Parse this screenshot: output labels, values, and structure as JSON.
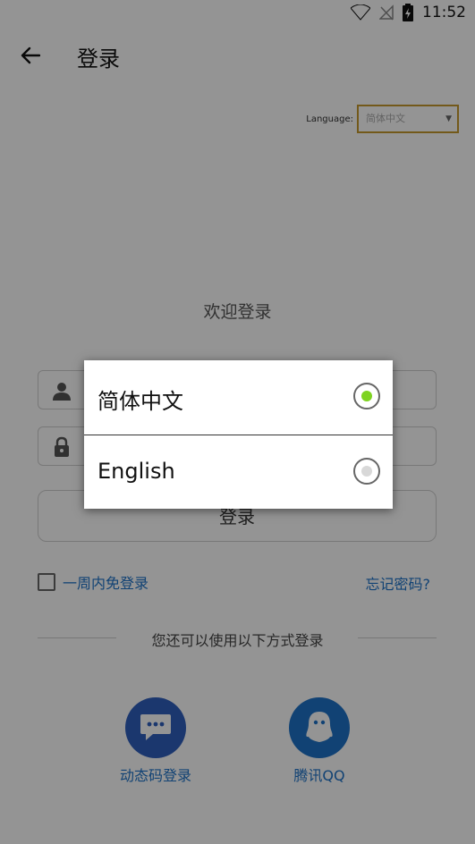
{
  "status_bar": {
    "time": "11:52",
    "icons": [
      "wifi-icon",
      "signal-off-icon",
      "battery-charging-icon"
    ]
  },
  "appbar": {
    "back_icon": "arrow-left-icon",
    "title": "登录"
  },
  "language": {
    "label": "Language:",
    "selected": "简体中文"
  },
  "form": {
    "welcome": "欢迎登录",
    "username_icon": "user-icon",
    "password_icon": "lock-icon",
    "login_button": "登录",
    "remember_label": "一周内免登录",
    "forgot_label": "忘记密码?"
  },
  "alt_login": {
    "divider_text": "您还可以使用以下方式登录",
    "items": [
      {
        "label": "动态码登录",
        "icon": "message-icon",
        "color": "#2f5fbe"
      },
      {
        "label": "腾讯QQ",
        "icon": "qq-icon",
        "color": "#1e73c8"
      }
    ]
  },
  "dialog": {
    "options": [
      {
        "label": "简体中文",
        "selected": true
      },
      {
        "label": "English",
        "selected": false
      }
    ],
    "selected_color": "#7ed321"
  }
}
